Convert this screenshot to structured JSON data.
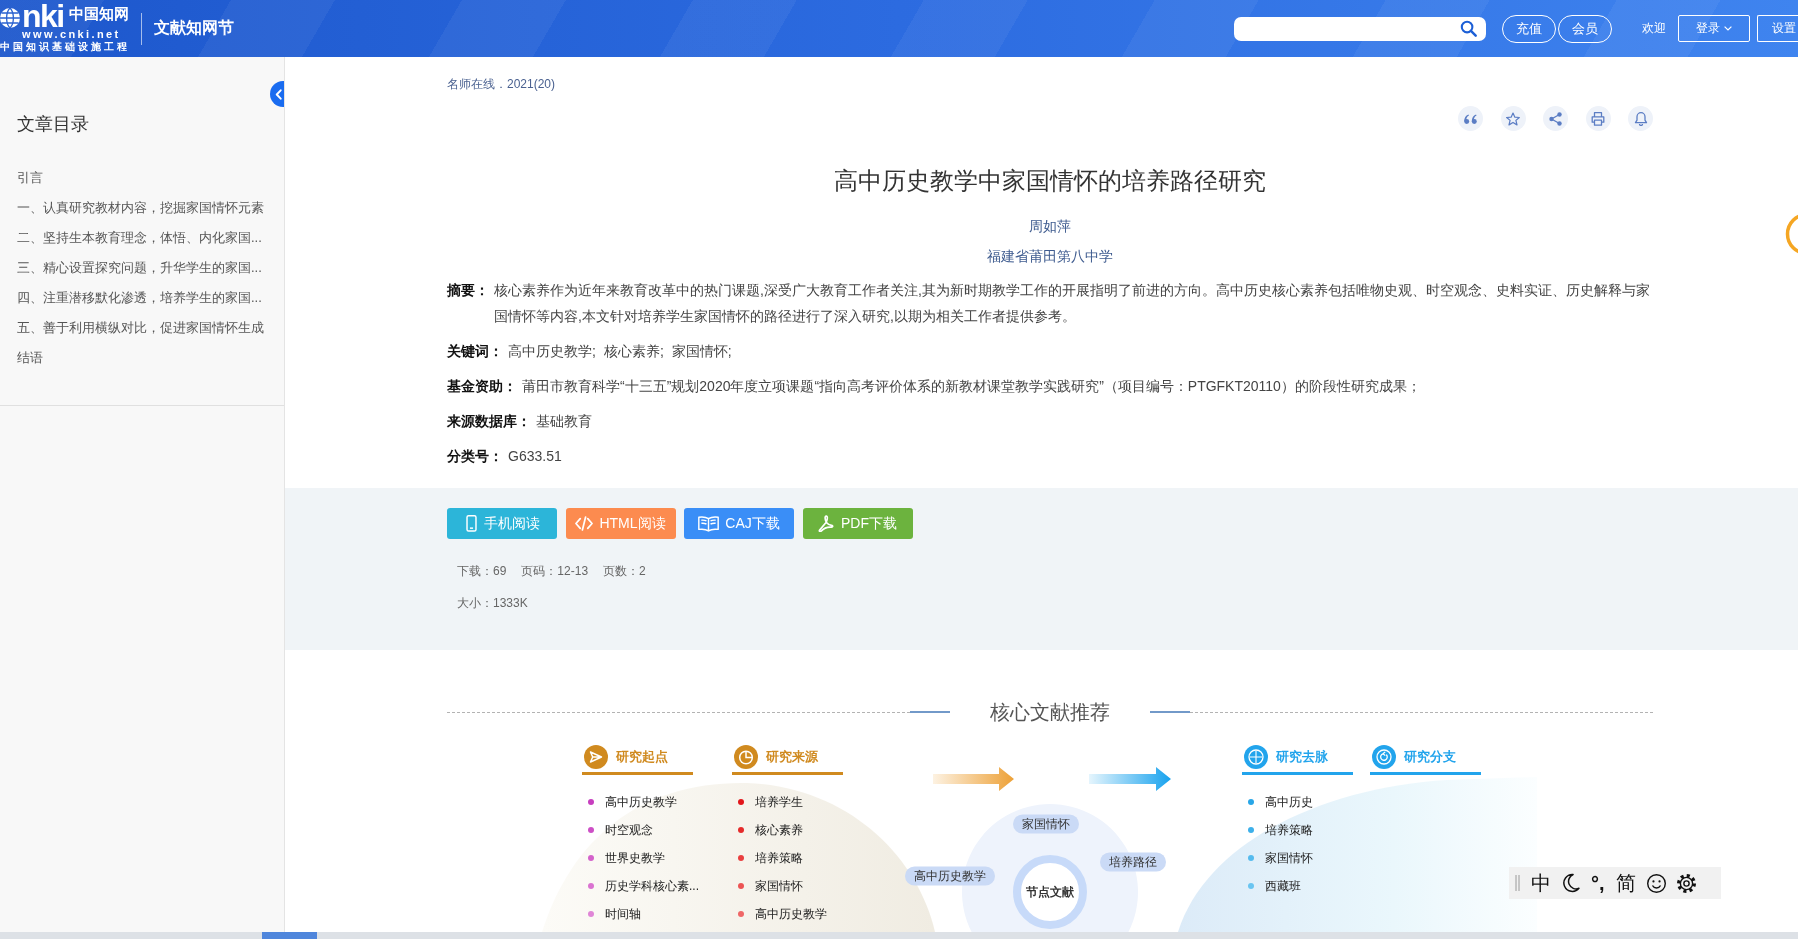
{
  "header": {
    "logo": {
      "wordmark": "nki",
      "name": "中国知网",
      "url": "www.cnki.net",
      "slogan": "中国知识基础设施工程"
    },
    "section": "文献知网节",
    "buttons": [
      {
        "label": "充值"
      },
      {
        "label": "会员"
      }
    ],
    "greeting": "欢迎",
    "login": {
      "label": "登录"
    },
    "settings": {
      "label": "设置"
    }
  },
  "sidebar": {
    "title": "文章目录",
    "items": [
      "引言",
      "一、认真研究教材内容，挖掘家国情怀元素",
      "二、坚持生本教育理念，体悟、内化家国...",
      "三、精心设置探究问题，升华学生的家国...",
      "四、注重潜移默化渗透，培养学生的家国...",
      "五、善于利用横纵对比，促进家国情怀生成",
      "结语"
    ]
  },
  "article": {
    "source": "名师在线．2021(20)",
    "title": "高中历史教学中家国情怀的培养路径研究",
    "author": "周如萍",
    "affiliation": "福建省莆田第八中学",
    "fields": [
      {
        "kind": "text",
        "label": "摘要：",
        "value": "核心素养作为近年来教育改革中的热门课题,深受广大教育工作者关注,其为新时期教学工作的开展指明了前进的方向。高中历史核心素养包括唯物史观、时空观念、史料实证、历史解释与家国情怀等内容,本文针对培养学生家国情怀的路径进行了深入研究,以期为相关工作者提供参考。"
      },
      {
        "kind": "links",
        "label": "关键词：",
        "items": [
          "高中历史教学;",
          "核心素养;",
          "家国情怀;"
        ]
      },
      {
        "kind": "text",
        "label": "基金资助：",
        "value": "莆田市教育科学“十三五”规划2020年度立项课题“指向高考评价体系的新教材课堂教学实践研究”（项目编号：PTGFKT20110）的阶段性研究成果；"
      },
      {
        "kind": "text",
        "label": "来源数据库：",
        "value": "基础教育"
      },
      {
        "kind": "text",
        "label": "分类号：",
        "value": "G633.51"
      }
    ]
  },
  "downloads": {
    "buttons": [
      {
        "kind": "mobile",
        "label": "手机阅读"
      },
      {
        "kind": "html",
        "label": "HTML阅读"
      },
      {
        "kind": "caj",
        "label": "CAJ下载"
      },
      {
        "kind": "pdf",
        "label": "PDF下载"
      }
    ],
    "stats": [
      [
        "下载：69",
        "页码：12-13",
        "页数：2"
      ],
      [
        "大小：1333K"
      ]
    ]
  },
  "recommend": {
    "title": "核心文献推荐",
    "upstream": [
      {
        "kind": "start",
        "title": "研究起点",
        "color": "#d08a1f",
        "items": [
          {
            "label": "高中历史教学",
            "color": "#c73ebf"
          },
          {
            "label": "时空观念",
            "color": "#cd4fc6"
          },
          {
            "label": "世界史教学",
            "color": "#d462cb"
          },
          {
            "label": "历史学科核心素...",
            "color": "#da73d1"
          },
          {
            "label": "时间轴",
            "color": "#e086d7"
          }
        ]
      },
      {
        "kind": "source",
        "title": "研究来源",
        "color": "#d08a1f",
        "items": [
          {
            "label": "培养学生",
            "color": "#e2161b"
          },
          {
            "label": "核心素养",
            "color": "#e52b2b"
          },
          {
            "label": "培养策略",
            "color": "#e93f3f"
          },
          {
            "label": "家国情怀",
            "color": "#ec5454"
          },
          {
            "label": "高中历史教学",
            "color": "#ef6767"
          }
        ]
      }
    ],
    "node": {
      "label": "节点文献",
      "tags": [
        "家国情怀",
        "高中历史教学",
        "培养路径"
      ]
    },
    "downstream": [
      {
        "kind": "trend",
        "title": "研究去脉",
        "color": "#22a4ec",
        "items": [
          {
            "label": "高中历史",
            "color": "#28a6e7"
          },
          {
            "label": "培养策略",
            "color": "#3db0ea"
          },
          {
            "label": "家国情怀",
            "color": "#55bbee"
          },
          {
            "label": "西藏班",
            "color": "#6ac5f1"
          }
        ]
      },
      {
        "kind": "branch",
        "title": "研究分支",
        "color": "#22a4ec"
      }
    ]
  },
  "ime_toolbar": {
    "mode": "中",
    "punctuation": "°,",
    "script": "简"
  }
}
